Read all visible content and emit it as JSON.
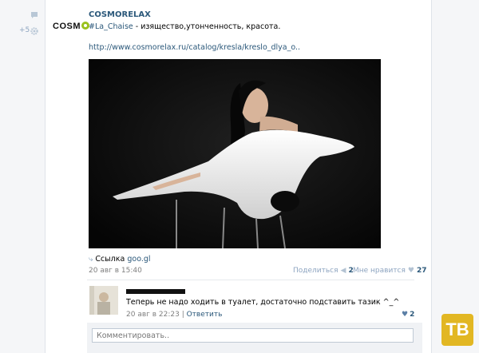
{
  "rail": {
    "like_count": "+5"
  },
  "post": {
    "logo_text": "COSM",
    "author": "COSMORELAX",
    "hashtag": "#La_Chaise",
    "text": " - изящество,утонченность, красота.",
    "link": "http://www.cosmorelax.ru/catalog/kresla/kreslo_dlya_o..",
    "source_label": "Ссылка",
    "source_link": "goo.gl",
    "date": "20 авг в 15:40",
    "share_label": "Поделиться",
    "share_count": "2",
    "like_label": "Мне нравится",
    "like_count": "27"
  },
  "comment": {
    "text": "Теперь не надо ходить в туалет, достаточно подставить тазик ^_^",
    "date": "20 авг в 22:23",
    "reply_label": "Ответить",
    "like_count": "2"
  },
  "compose": {
    "placeholder": "Комментировать.."
  },
  "watermark": {
    "text": "ТВ"
  },
  "colors": {
    "link": "#2b587a",
    "meta": "#7f7f7f",
    "logo_accent": "#9ac11c",
    "badge": "#e2b723"
  }
}
